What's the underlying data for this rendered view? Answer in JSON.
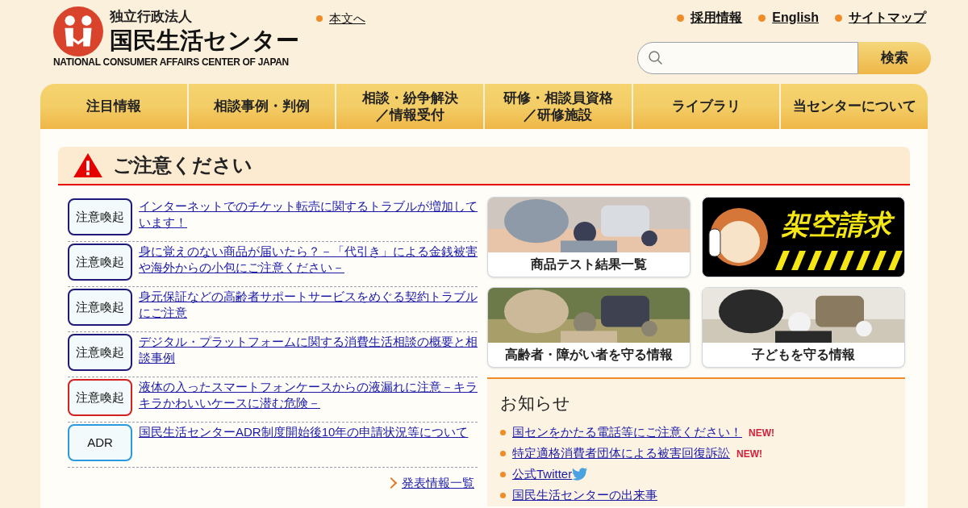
{
  "header": {
    "org_type": "独立行政法人",
    "org_name": "国民生活センター",
    "org_name_en": "NATIONAL CONSUMER AFFAIRS CENTER OF JAPAN",
    "skip_link": "本文へ",
    "utility_links": [
      "採用情報",
      "English",
      "サイトマップ"
    ],
    "search": {
      "button": "検索"
    }
  },
  "nav": [
    {
      "lines": [
        "注目情報"
      ]
    },
    {
      "lines": [
        "相談事例・判例"
      ]
    },
    {
      "lines": [
        "相談・紛争解決",
        "／情報受付"
      ]
    },
    {
      "lines": [
        "研修・相談員資格",
        "／研修施設"
      ]
    },
    {
      "lines": [
        "ライブラリ"
      ]
    },
    {
      "lines": [
        "当センターについて"
      ]
    }
  ],
  "caution": {
    "title": "ご注意ください",
    "items": [
      {
        "tag": "注意喚起",
        "color": "#1f1a7a",
        "text": "インターネットでのチケット転売に関するトラブルが増加しています！"
      },
      {
        "tag": "注意喚起",
        "color": "#1f1a7a",
        "text": "身に覚えのない商品が届いたら？－「代引き」による金銭被害や海外からの小包にご注意ください－"
      },
      {
        "tag": "注意喚起",
        "color": "#1f1a7a",
        "text": "身元保証などの高齢者サポートサービスをめぐる契約トラブルにご注意"
      },
      {
        "tag": "注意喚起",
        "color": "#1f1a7a",
        "text": "デジタル・プラットフォームに関する消費生活相談の概要と相談事例"
      },
      {
        "tag": "注意喚起",
        "color": "#d42020",
        "text": "液体の入ったスマートフォンケースからの液漏れに注意－キラキラかわいいケースに潜む危険－"
      },
      {
        "tag": "ADR",
        "color": "#2a9ae0",
        "text": "国民生活センターADR制度開始後10年の申請状況等について"
      }
    ],
    "more": "発表情報一覧"
  },
  "tiles": [
    {
      "label": "商品テスト結果一覧"
    },
    {
      "kind": "banner",
      "label": "架空請求"
    },
    {
      "label": "高齢者・障がい者を守る情報"
    },
    {
      "label": "子どもを守る情報"
    }
  ],
  "news": {
    "title": "お知らせ",
    "items": [
      {
        "kind": "plain",
        "text": "国センをかたる電話等にご注意ください！",
        "badge": "NEW!"
      },
      {
        "kind": "plain",
        "text": "特定適格消費者団体による被害回復訴訟",
        "badge": "NEW!"
      },
      {
        "kind": "social",
        "text": "公式Twitter"
      },
      {
        "kind": "plain",
        "text": "国民生活センターの出来事"
      }
    ]
  }
}
